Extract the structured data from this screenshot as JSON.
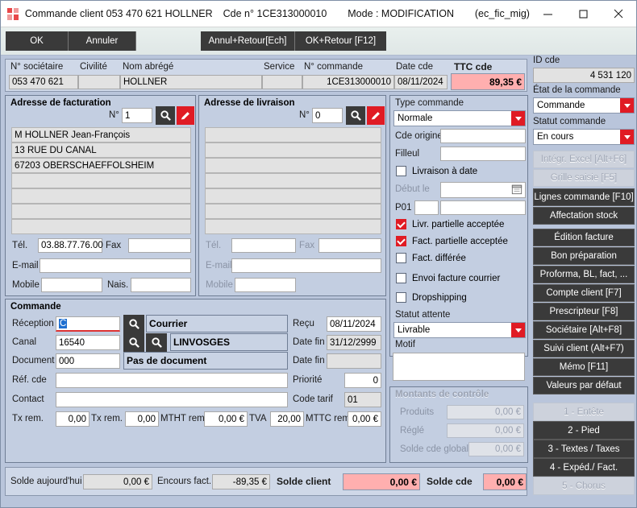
{
  "window": {
    "title_parts": [
      "Commande client 053 470 621 HOLLNER",
      "Cde n° 1CE313000010",
      "Mode : MODIFICATION",
      "(ec_fic_mig)"
    ],
    "minimize": "—",
    "maximize": "□",
    "close": "✕"
  },
  "toolbar": {
    "ok": "OK",
    "cancel": "Annuler",
    "cancel_return": "Annul+Retour[Ech]",
    "ok_return": "OK+Retour [F12]"
  },
  "infostrip": {
    "labels": [
      "N° sociétaire",
      "Civilité",
      "Nom abrégé",
      "Service",
      "N° commande",
      "Date cde",
      "TTC cde"
    ],
    "values": [
      "053 470 621",
      "",
      "HOLLNER",
      "",
      "1CE313000010",
      "08/11/2024",
      "89,35 €"
    ]
  },
  "billing": {
    "title": "Adresse de facturation",
    "num_label": "N°",
    "num_value": "1",
    "search_icon": "magnifier-icon",
    "edit_icon": "pencil-icon",
    "lines": [
      "M HOLLNER Jean-François",
      "13 RUE DU CANAL",
      "67203 OBERSCHAEFFOLSHEIM",
      "",
      "",
      "",
      ""
    ],
    "tel_label": "Tél.",
    "tel_value": "03.88.77.76.00",
    "fax_label": "Fax",
    "fax_value": "",
    "email_label": "E-mail",
    "email_value": "",
    "mobile_label": "Mobile",
    "mobile_value": "",
    "nais_label": "Nais.",
    "nais_value": ""
  },
  "delivery": {
    "title": "Adresse de livraison",
    "num_label": "N°",
    "num_value": "0",
    "search_icon": "magnifier-icon",
    "edit_icon": "pencil-icon",
    "lines": [
      "",
      "",
      "",
      "",
      "",
      "",
      ""
    ],
    "tel_label": "Tél.",
    "tel_value": "",
    "fax_label": "Fax",
    "fax_value": "",
    "email_label": "E-mail",
    "email_value": "",
    "mobile_label": "Mobile",
    "mobile_value": ""
  },
  "order_type": {
    "title": "Type commande",
    "type_value": "Normale",
    "cde_origine_label": "Cde origine",
    "cde_origine_value": "",
    "filleul_label": "Filleul",
    "filleul_value": "",
    "livraison_date_label": "Livraison à date",
    "livraison_date_checked": false,
    "debut_le_label": "Début le",
    "debut_le_value": "",
    "p01_label": "P01",
    "p01_code": "",
    "p01_value": "",
    "livr_partielle_label": "Livr. partielle acceptée",
    "livr_partielle_checked": true,
    "fact_partielle_label": "Fact. partielle acceptée",
    "fact_partielle_checked": true,
    "fact_differee_label": "Fact. différée",
    "fact_differee_checked": false,
    "envoi_facture_label": "Envoi facture courrier",
    "envoi_facture_checked": false,
    "dropshipping_label": "Dropshipping",
    "dropshipping_checked": false,
    "statut_attente_label": "Statut attente",
    "statut_attente_value": "Livrable",
    "motif_label": "Motif",
    "motif_value": ""
  },
  "control_amounts": {
    "title": "Montants de contrôle",
    "rows": [
      {
        "label": "Produits",
        "value": "0,00 €"
      },
      {
        "label": "Réglé",
        "value": "0,00 €"
      },
      {
        "label": "Solde cde global",
        "value": "0,00 €"
      }
    ]
  },
  "order": {
    "title": "Commande",
    "reception_label": "Réception",
    "reception_value": "C",
    "reception_desc": "Courrier",
    "canal_label": "Canal",
    "canal_value": "16540",
    "canal_desc": "LINVOSGES",
    "document_label": "Document",
    "document_value": "000",
    "document_desc": "Pas de document",
    "ref_cde_label": "Réf. cde",
    "ref_cde_value": "",
    "contact_label": "Contact",
    "contact_value": "",
    "recu_label": "Reçu",
    "recu_value": "08/11/2024",
    "date_fin1_label": "Date fin",
    "date_fin1_value": "31/12/2999",
    "date_fin2_label": "Date fin",
    "date_fin2_value": "",
    "priorite_label": "Priorité",
    "priorite_value": "0",
    "code_tarif_label": "Code tarif",
    "code_tarif_value": "01",
    "tx_rem_label": "Tx rem.",
    "tx_rem_value": "0,00",
    "tx_rem_l_label": "Tx rem. l.",
    "tx_rem_l_value": "0,00",
    "mtht_rem_label": "MTHT rem.",
    "mtht_rem_value": "0,00 €",
    "tva_label": "TVA",
    "tva_value": "20,00",
    "mttc_rem_label": "MTTC rem.",
    "mttc_rem_value": "0,00 €"
  },
  "sidebar": {
    "id_cde_label": "ID cde",
    "id_cde_value": "4 531 120",
    "etat_label": "État de la commande",
    "etat_value": "Commande",
    "statut_label": "Statut commande",
    "statut_value": "En cours",
    "buttons": [
      {
        "label": "Intégr. Excel [Alt+F6]",
        "disabled": true
      },
      {
        "label": "Grille saisie [F5]",
        "disabled": true
      },
      {
        "label": "Lignes commande [F10]",
        "disabled": false
      },
      {
        "label": "Affectation stock",
        "disabled": false
      },
      {
        "label": "Édition facture",
        "disabled": false
      },
      {
        "label": "Bon préparation",
        "disabled": false
      },
      {
        "label": "Proforma, BL, fact, ...",
        "disabled": false
      },
      {
        "label": "Compte client [F7]",
        "disabled": false
      },
      {
        "label": "Prescripteur [F8]",
        "disabled": false
      },
      {
        "label": "Sociétaire [Alt+F8]",
        "disabled": false
      },
      {
        "label": "Suivi client (Alt+F7)",
        "disabled": false
      },
      {
        "label": "Mémo [F11]",
        "disabled": false
      },
      {
        "label": "Valeurs par défaut",
        "disabled": false
      }
    ],
    "tabs": [
      {
        "label": "1 - Entête",
        "disabled": true
      },
      {
        "label": "2 - Pied",
        "disabled": false
      },
      {
        "label": "3 - Textes / Taxes",
        "disabled": false
      },
      {
        "label": "4 - Expéd./ Fact.",
        "disabled": false
      },
      {
        "label": "5 - Chorus",
        "disabled": true
      }
    ]
  },
  "statusbar": {
    "solde_auj_label": "Solde aujourd'hui",
    "solde_auj_value": "0,00 €",
    "encours_label": "Encours fact.",
    "encours_value": "-89,35 €",
    "solde_client_label": "Solde client",
    "solde_client_value": "0,00 €",
    "solde_cde_label": "Solde cde",
    "solde_cde_value": "0,00 €"
  },
  "colors": {
    "accent_red": "#e01b24",
    "dark_button": "#3a3a3a",
    "panel_blue": "#c3cee1",
    "pink_highlight": "#ffafaf"
  }
}
